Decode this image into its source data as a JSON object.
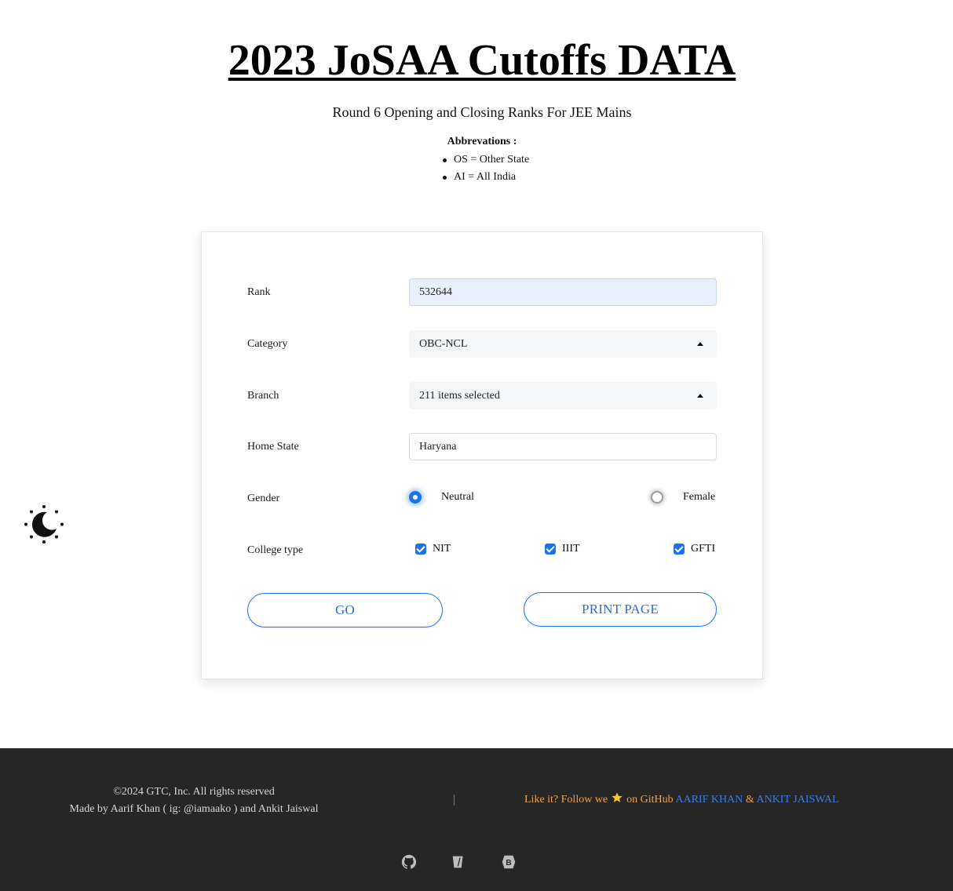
{
  "header": {
    "title": "2023 JoSAA Cutoffs DATA",
    "subtitle": "Round 6 Opening and Closing Ranks For JEE Mains",
    "abbreviations_heading": "Abbrevations :",
    "abbreviations": [
      "OS = Other State",
      "AI = All India"
    ]
  },
  "theme_toggle": {
    "icon": "moon-sun-icon"
  },
  "form": {
    "rank": {
      "label": "Rank",
      "value": "532644"
    },
    "category": {
      "label": "Category",
      "value": "OBC-NCL"
    },
    "branch": {
      "label": "Branch",
      "value": "211 items selected"
    },
    "home_state": {
      "label": "Home State",
      "value": "Haryana"
    },
    "gender": {
      "label": "Gender",
      "options": [
        "Neutral",
        "Female"
      ],
      "selected": "Neutral"
    },
    "college_type": {
      "label": "College type",
      "options": [
        "NIT",
        "IIIT",
        "GFTI"
      ],
      "checked": [
        true,
        true,
        true
      ]
    },
    "go_label": "GO",
    "print_label": "PRINT PAGE"
  },
  "footer": {
    "copyright": "©2024 GTC, Inc. All rights reserved",
    "made_by": "Made by Aarif Khan ( ig: @iamaako ) and Ankit Jaiswal",
    "follow_text": "Like it? Follow we",
    "follow_suffix": "on GitHub",
    "author1": "AARIF KHAN",
    "amp": "&",
    "author2": "ANKIT JAISWAL",
    "icons": [
      "github-icon",
      "flask-icon",
      "bootstrap-icon"
    ]
  },
  "colors": {
    "accent": "#1a73e8",
    "footer_bg": "#262626",
    "footer_highlight": "#f0a24e",
    "footer_link": "#3d7be0"
  }
}
